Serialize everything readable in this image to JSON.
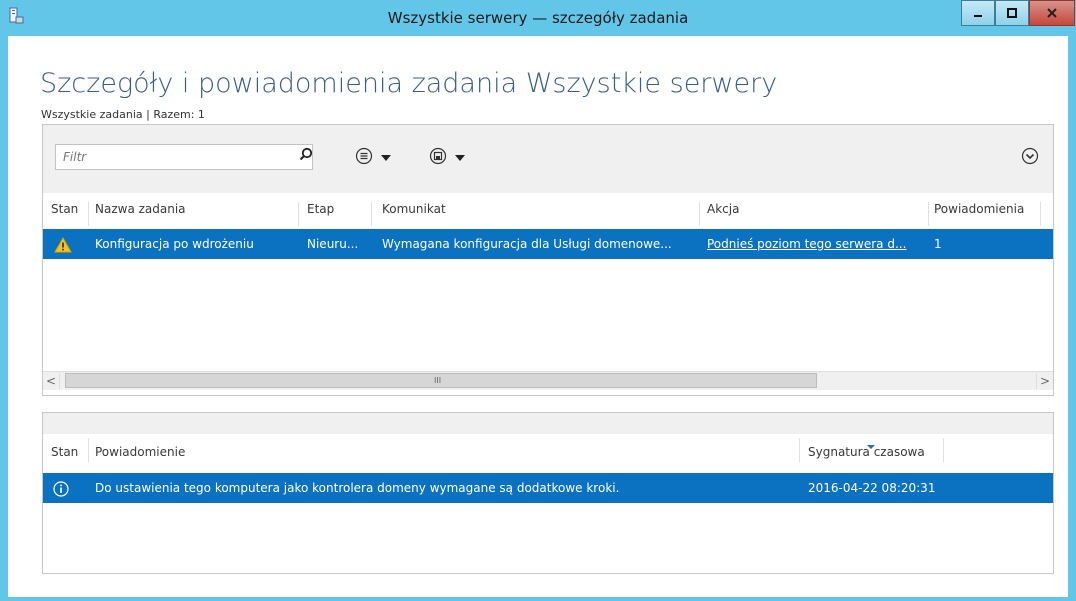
{
  "window": {
    "title": "Wszystkie serwery — szczegóły zadania"
  },
  "page": {
    "title": "Szczegóły i powiadomienia zadania Wszystkie serwery",
    "breadcrumb": "Wszystkie zadania | Razem: 1"
  },
  "filter": {
    "placeholder": "Filtr"
  },
  "tasks": {
    "columns": [
      "Stan",
      "Nazwa zadania",
      "Etap",
      "Komunikat",
      "Akcja",
      "Powiadomienia"
    ],
    "row": {
      "name": "Konfiguracja po wdrożeniu",
      "stage": "Nieuru...",
      "message": "Wymagana konfiguracja dla Usługi domenowe...",
      "action": "Podnieś poziom tego serwera d...",
      "notifications": "1"
    }
  },
  "scrollbar": {
    "grip": "III"
  },
  "notifications": {
    "columns": [
      "Stan",
      "Powiadomienie",
      "Sygnatura czasowa"
    ],
    "row": {
      "text": "Do ustawienia tego komputera jako kontrolera domeny wymagane są dodatkowe kroki.",
      "timestamp": "2016-04-22 08:20:31"
    }
  },
  "colors": {
    "selection": "#0a72c1",
    "titlebar": "#62c6e8",
    "title_text": "#3a5e86"
  }
}
